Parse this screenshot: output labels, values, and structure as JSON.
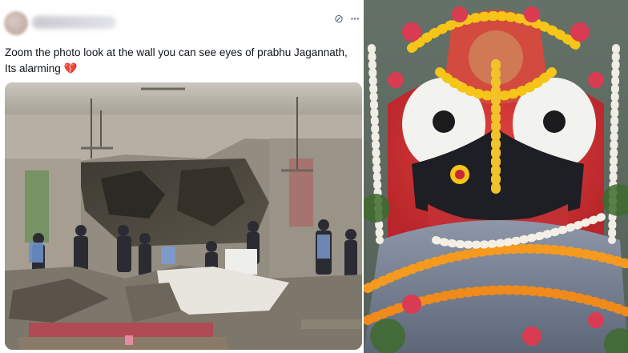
{
  "tweet": {
    "text_line1": "Zoom the photo look at the wall you can see eyes of prabhu Jagannath,",
    "text_line2": "Its alarming",
    "emoji": "💔",
    "icons": {
      "grok": "grok-icon",
      "more": "more-icon"
    },
    "more_glyph": "···",
    "grok_glyph": "⊘"
  },
  "images": {
    "left_photo": "collapsed-ceiling-hall-photo",
    "right_photo": "jagannath-idol-garlanded-photo"
  },
  "colors": {
    "text": "#0f1419",
    "icon": "#536471",
    "heart": "#e0245e"
  }
}
